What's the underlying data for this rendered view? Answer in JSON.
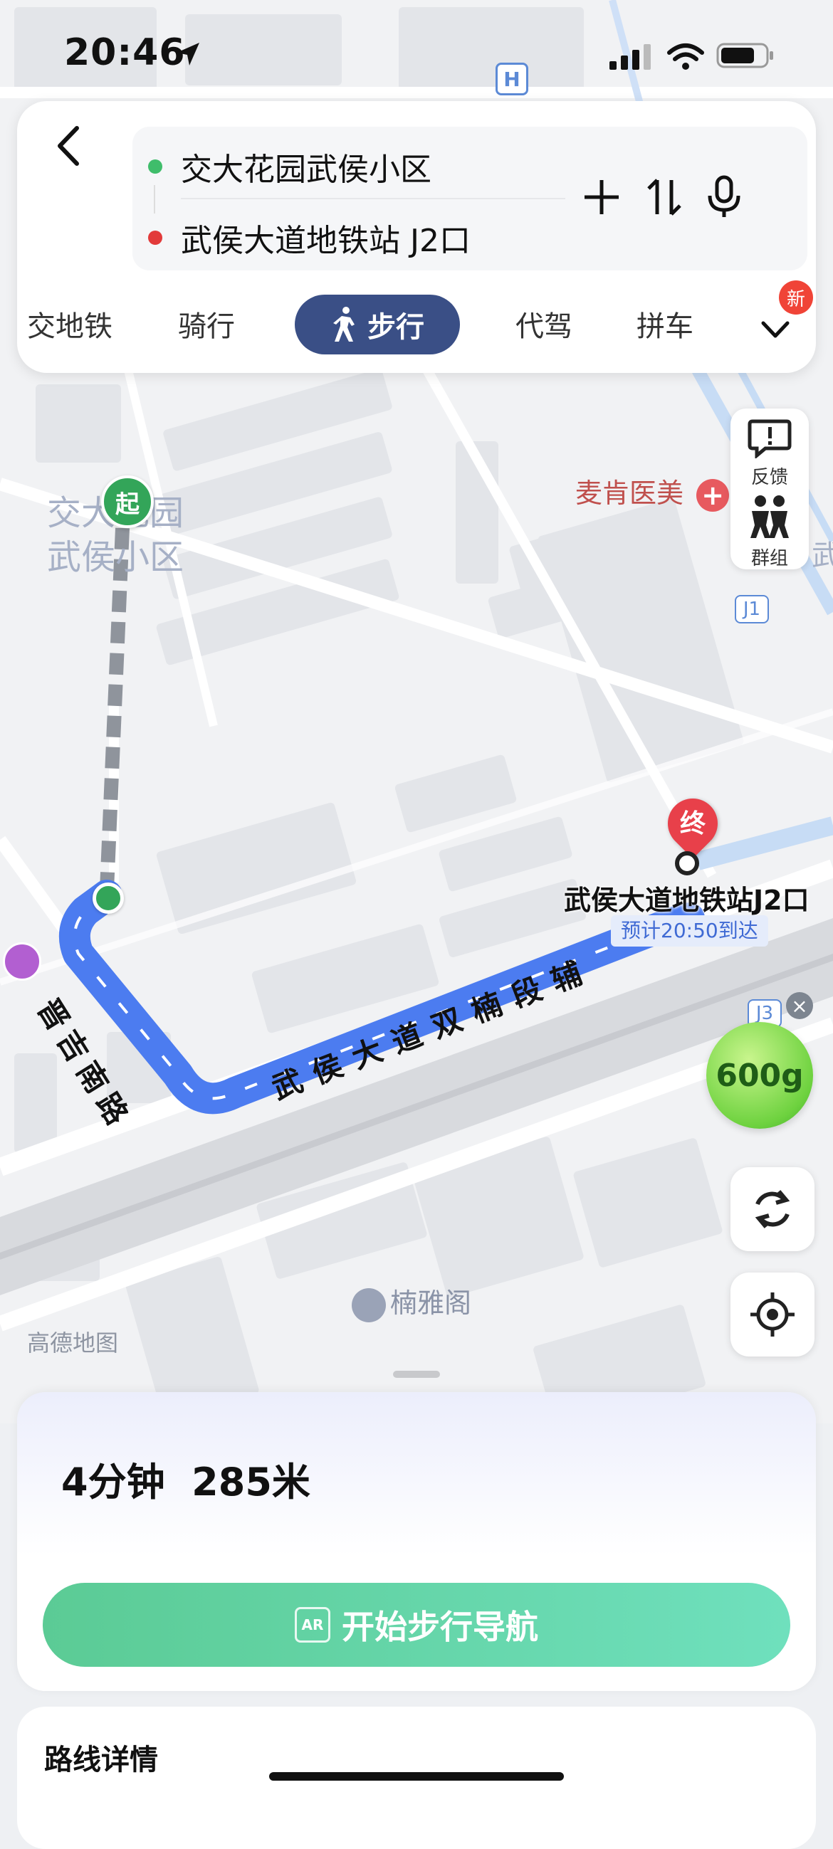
{
  "status_bar": {
    "time": "20:46"
  },
  "route_inputs": {
    "origin": "交大花园武侯小区",
    "destination": "武侯大道地铁站 J2口"
  },
  "transport_tabs": {
    "items": [
      "交地铁",
      "骑行",
      "步行",
      "代驾",
      "拼车"
    ],
    "active": "步行",
    "badge": "新"
  },
  "map": {
    "start_marker": "起",
    "end_marker": "终",
    "origin_label_line1": "交大花园",
    "origin_label_line2": "武侯小区",
    "poi_clinic": "麦肯医美",
    "poi_bottom": "楠雅阁",
    "road_1": "晋吉南路",
    "road_2": "武侯大道双楠段辅",
    "destination_label": "武侯大道地铁站J2口",
    "eta_label": "预计20:50到达",
    "exit_j1": "J1",
    "exit_j3": "J3",
    "hospital_badge": "H",
    "edge_text": "武",
    "watermark": "高德地图",
    "energy_value": "600g"
  },
  "side_tools": {
    "feedback": "反馈",
    "group": "群组"
  },
  "bottom_sheet": {
    "summary": "4分钟  285米",
    "start_button": "开始步行导航",
    "ar_label": "AR"
  },
  "route_details": {
    "title": "路线详情"
  },
  "colors": {
    "accent": "#3a4f86",
    "route": "#4c7cf0",
    "start_green": "#33a559",
    "end_red": "#e8404a",
    "nav_button": "#5bcb95"
  }
}
